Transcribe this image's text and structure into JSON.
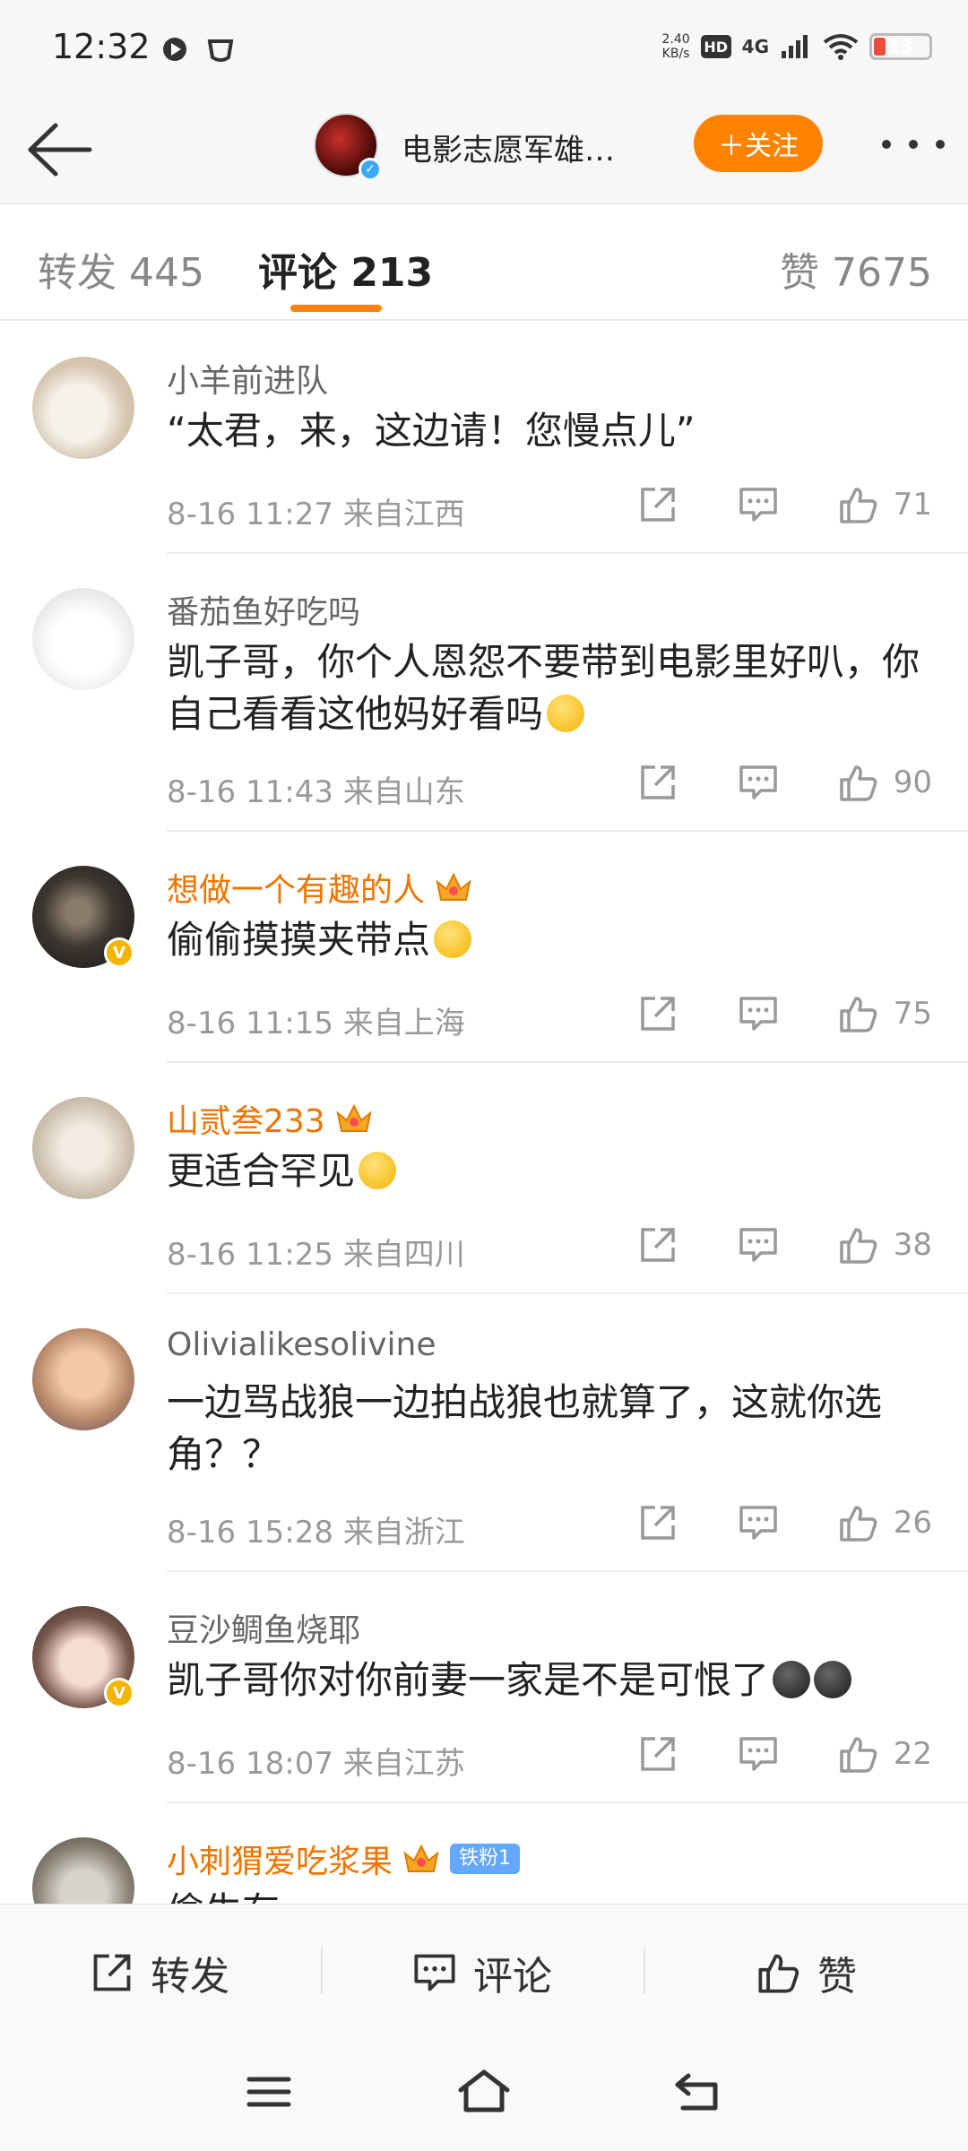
{
  "status": {
    "time": "12:32",
    "net_speed_value": "2.40",
    "net_speed_unit": "KB/s",
    "hd": "HD",
    "network": "4G",
    "battery": "13"
  },
  "header": {
    "title": "电影志愿军雄…",
    "follow_label": "＋关注"
  },
  "tabs": {
    "repost": "转发 445",
    "comment": "评论 213",
    "likes": "赞 7675"
  },
  "comments": [
    {
      "name": "小羊前进队",
      "text": "“太君，来，这边请！您慢点儿”",
      "time": "8-16 11:27 来自江西",
      "likes": "71"
    },
    {
      "name": "番茄鱼好吃吗",
      "text": "凯子哥，你个人恩怨不要带到电影里好叭，你自己看看这他妈好看吗",
      "time": "8-16 11:43 来自山东",
      "likes": "90"
    },
    {
      "name": "想做一个有趣的人",
      "text": "偷偷摸摸夹带点",
      "time": "8-16 11:15 来自上海",
      "likes": "75"
    },
    {
      "name": "山贰叁233",
      "text": "更适合罕见",
      "time": "8-16 11:25 来自四川",
      "likes": "38"
    },
    {
      "name": "Olivialikesolivine",
      "text": "一边骂战狼一边拍战狼也就算了，这就你选角？？",
      "time": "8-16 15:28 来自浙江",
      "likes": "26"
    },
    {
      "name": "豆沙鲷鱼烧耶",
      "text": "凯子哥你对你前妻一家是不是可恨了",
      "time": "8-16 18:07 来自江苏",
      "likes": "22"
    },
    {
      "name": "小刺猬爱吃浆果",
      "fan_badge": "铁粉1",
      "text": "偷生有"
    }
  ],
  "bottom": {
    "repost": "转发",
    "comment": "评论",
    "like": "赞"
  },
  "icons": [
    "back-arrow-icon",
    "more-icon",
    "share-icon",
    "comment-icon",
    "thumbs-up-icon",
    "crown-icon",
    "menu-icon",
    "home-icon",
    "return-icon"
  ],
  "colors": {
    "accent": "#ff8200",
    "vip_name": "#f07400",
    "verified_blue": "#3aa8ff",
    "fan_badge": "#63a7ff"
  }
}
